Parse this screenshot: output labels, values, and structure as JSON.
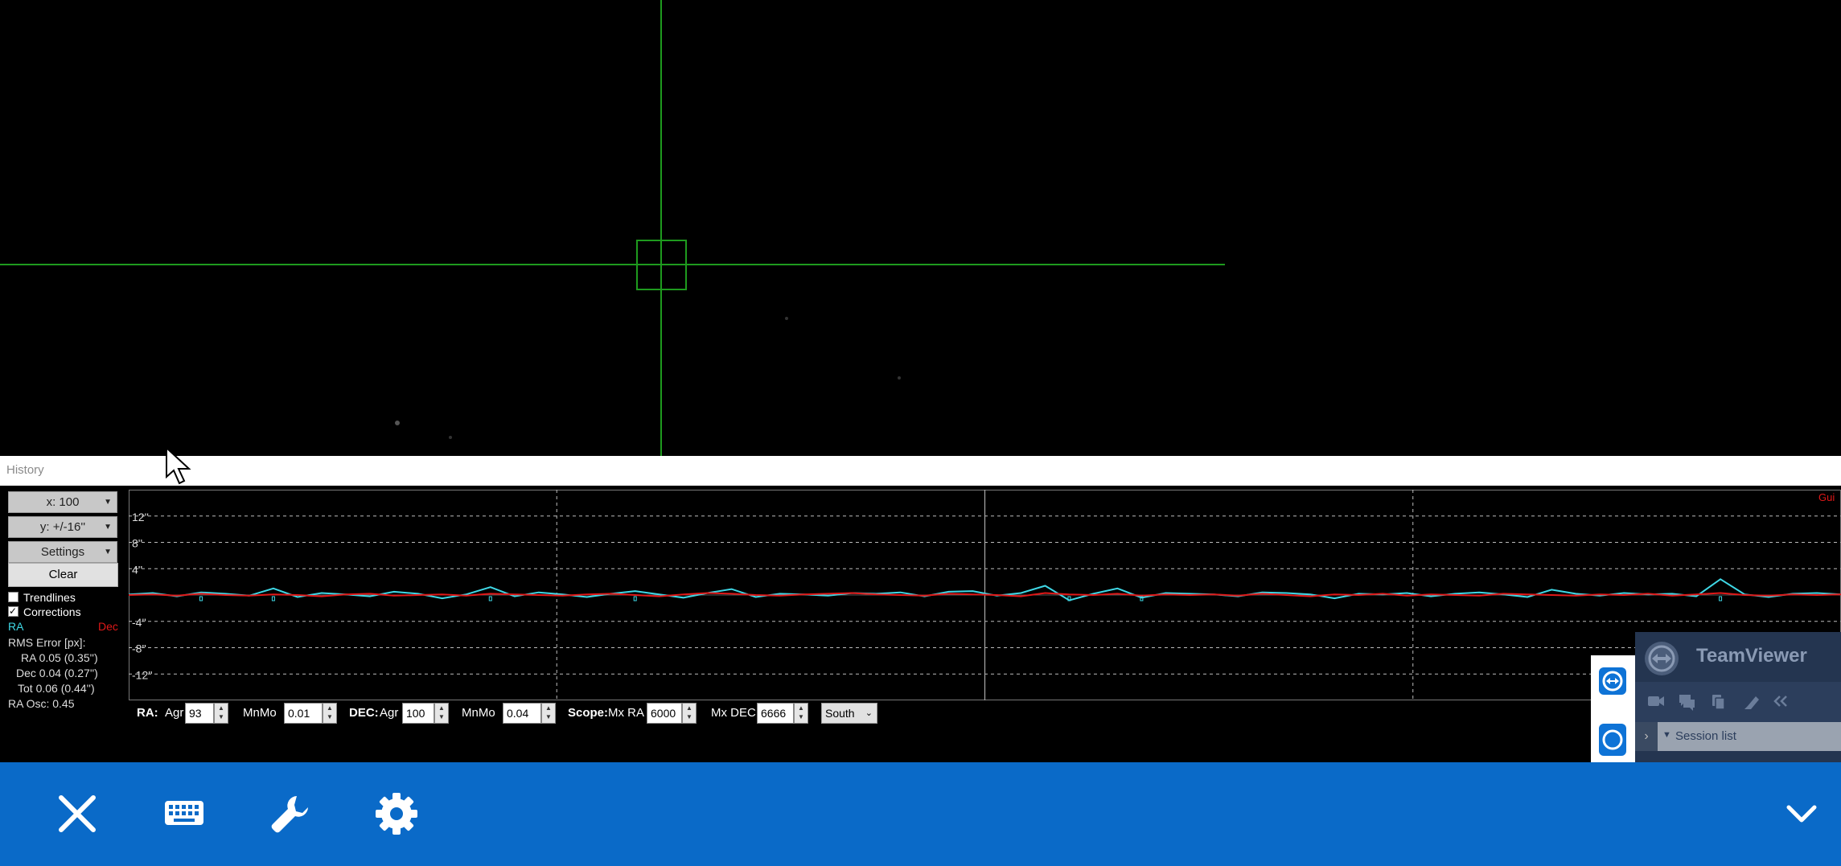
{
  "history": {
    "title": "History"
  },
  "controls": {
    "x_scale": "x: 100",
    "y_scale": "y: +/-16''",
    "settings": "Settings",
    "clear": "Clear",
    "trendlines_label": "Trendlines",
    "trendlines_checked": false,
    "corrections_label": "Corrections",
    "corrections_checked": true,
    "legend_ra": "RA",
    "legend_dec": "Dec",
    "rms_title": "RMS Error [px]:",
    "rms_ra": "RA  0.05 (0.35'')",
    "rms_dec": "Dec  0.04 (0.27'')",
    "rms_tot": "Tot  0.06 (0.44'')",
    "ra_osc": "RA Osc: 0.45"
  },
  "chart_data": {
    "type": "line",
    "y_tick_labels": [
      "12''",
      "8''",
      "4''",
      "-4''",
      "-8''",
      "-12''"
    ],
    "ylim": [
      -16,
      16
    ],
    "grid": true,
    "corner_label": "Gui",
    "series": [
      {
        "name": "RA",
        "color": "#3fd8e6",
        "values": [
          0.1,
          0.3,
          -0.2,
          0.4,
          0.2,
          -0.1,
          1.0,
          -0.3,
          0.3,
          0.1,
          -0.2,
          0.5,
          0.2,
          -0.5,
          0.1,
          1.2,
          -0.2,
          0.4,
          0.1,
          -0.3,
          0.2,
          0.6,
          0.1,
          -0.4,
          0.3,
          0.9,
          -0.3,
          0.2,
          0.1,
          -0.1,
          0.3,
          0.2,
          0.4,
          -0.2,
          0.5,
          0.6,
          -0.1,
          0.3,
          1.4,
          -0.8,
          0.2,
          1.0,
          -0.4,
          0.3,
          0.2,
          0.1,
          -0.2,
          0.4,
          0.3,
          0.1,
          -0.5,
          0.2,
          0.1,
          0.3,
          -0.2,
          0.2,
          0.4,
          0.1,
          -0.3,
          0.8,
          0.2,
          -0.1,
          0.3,
          0.1,
          0.2,
          -0.2,
          2.4,
          0.1,
          -0.3,
          0.2,
          0.3,
          0.1
        ]
      },
      {
        "name": "Dec",
        "color": "#e01818",
        "values": [
          0.0,
          0.1,
          -0.1,
          0.2,
          0.0,
          -0.1,
          0.1,
          0.0,
          -0.2,
          0.1,
          0.2,
          -0.1,
          0.0,
          0.1,
          -0.1,
          0.2,
          0.1,
          0.0,
          -0.1,
          0.1,
          0.2,
          0.0,
          -0.2,
          0.1,
          0.3,
          0.2,
          0.0,
          -0.1,
          0.1,
          0.2,
          0.3,
          0.1,
          0.0,
          -0.1,
          0.2,
          0.1,
          0.0,
          -0.2,
          0.3,
          0.1,
          0.0,
          0.2,
          -0.1,
          0.1,
          0.0,
          0.1,
          -0.1,
          0.2,
          0.0,
          -0.2,
          0.1,
          0.0,
          0.2,
          -0.1,
          0.1,
          0.0,
          -0.1,
          0.2,
          0.1,
          0.0,
          -0.1,
          0.1,
          0.0,
          0.2,
          -0.1,
          0.1,
          0.3,
          0.0,
          -0.1,
          0.1,
          0.0,
          0.1
        ]
      }
    ]
  },
  "params": {
    "ra_label": "RA:",
    "ra_agr_label": "Agr",
    "ra_agr": "93",
    "ra_mnmo_label": "MnMo",
    "ra_mnmo": "0.01",
    "dec_label": "DEC:",
    "dec_agr_label": "Agr",
    "dec_agr": "100",
    "dec_mnmo_label": "MnMo",
    "dec_mnmo": "0.04",
    "scope_label": "Scope:",
    "mx_ra_label": "Mx RA",
    "mx_ra": "6000",
    "mx_dec_label": "Mx DEC",
    "mx_dec": "6666",
    "dec_mode": "South"
  },
  "teamviewer": {
    "title": "TeamViewer",
    "session_list": "Session list"
  },
  "taskbar": {
    "icons": [
      "close-icon",
      "keyboard-icon",
      "wrench-icon",
      "gear-icon",
      "chevron-down-icon"
    ]
  },
  "colors": {
    "reticle": "#1e9a1e",
    "taskbar": "#0a6ac8",
    "ra": "#3fd8e6",
    "dec": "#e01818"
  }
}
